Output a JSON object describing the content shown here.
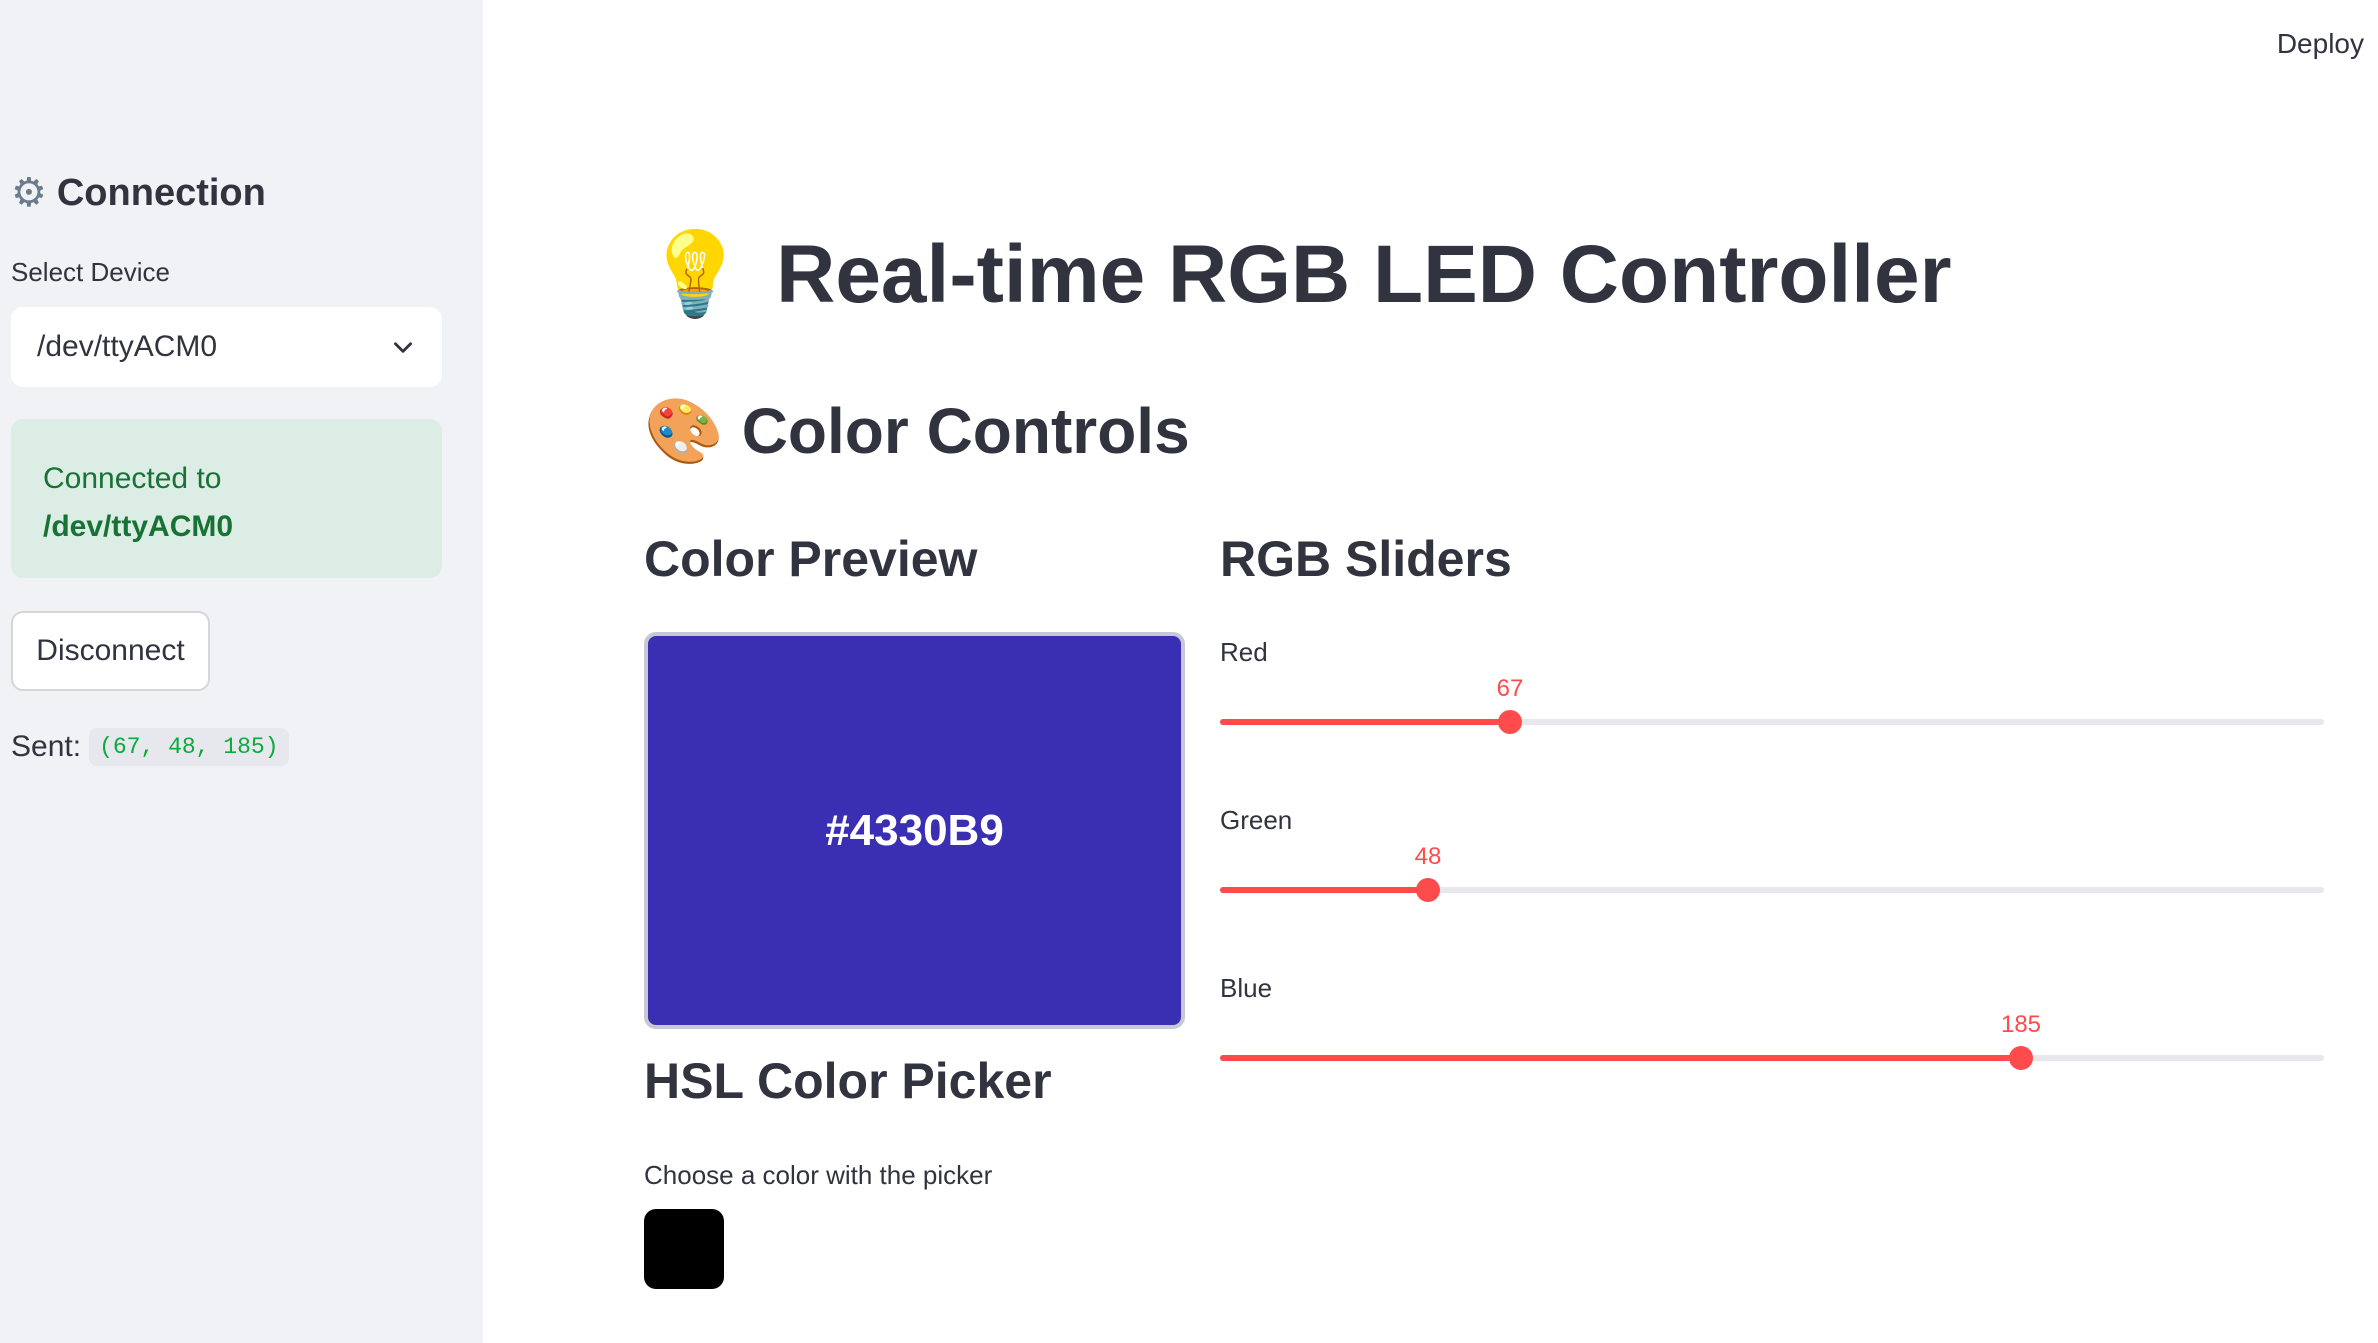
{
  "header": {
    "deploy_label": "Deploy"
  },
  "sidebar": {
    "section_title": "Connection",
    "select_label": "Select Device",
    "selected_device": "/dev/ttyACM0",
    "status_prefix": "Connected to",
    "status_device": "/dev/ttyACM0",
    "disconnect_label": "Disconnect",
    "sent_label": "Sent:",
    "sent_value": "(67, 48, 185)"
  },
  "main": {
    "title": "Real-time RGB LED Controller",
    "subtitle": "Color Controls",
    "preview_heading": "Color Preview",
    "preview_hex": "#4330B9",
    "preview_color": "#3a2fb3",
    "picker_heading": "HSL Color Picker",
    "picker_label": "Choose a color with the picker",
    "picker_color": "#000000",
    "sliders_heading": "RGB Sliders",
    "sliders": [
      {
        "label": "Red",
        "value": 67,
        "min": 0,
        "max": 255,
        "value_text": "67"
      },
      {
        "label": "Green",
        "value": 48,
        "min": 0,
        "max": 255,
        "value_text": "48"
      },
      {
        "label": "Blue",
        "value": 185,
        "min": 0,
        "max": 255,
        "value_text": "185"
      }
    ],
    "accent_color": "#ff4b4b"
  }
}
